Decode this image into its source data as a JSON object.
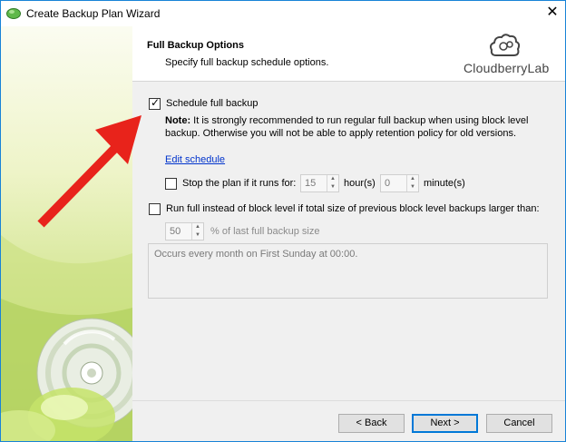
{
  "window": {
    "title": "Create Backup Plan Wizard",
    "close_glyph": "✕"
  },
  "header": {
    "title": "Full Backup Options",
    "subtitle": "Specify full backup schedule options.",
    "logo_text": "CloudberryLab"
  },
  "schedule": {
    "label": "Schedule full backup",
    "checked": true,
    "note_label": "Note:",
    "note_text": " It is strongly recommended to run regular full backup when using block level backup. Otherwise you will not be able to apply retention policy for old versions.",
    "edit_link": "Edit schedule"
  },
  "stop_plan": {
    "label": "Stop the plan if it runs for:",
    "checked": false,
    "hours_value": "15",
    "hours_unit": "hour(s)",
    "minutes_value": "0",
    "minutes_unit": "minute(s)"
  },
  "run_full": {
    "label": "Run full instead of block level if total size of previous block level backups larger than:",
    "checked": false,
    "percent_value": "50",
    "percent_label": "% of last full backup size"
  },
  "summary": {
    "text": "Occurs every month on First Sunday at 00:00."
  },
  "buttons": {
    "back": "< Back",
    "next": "Next >",
    "cancel": "Cancel"
  },
  "colors": {
    "accent": "#0078d7",
    "annotation_arrow": "#e8231b",
    "link": "#0033cc"
  },
  "icons": {
    "app": "cloud-icon",
    "spinner_up": "▲",
    "spinner_down": "▼"
  }
}
